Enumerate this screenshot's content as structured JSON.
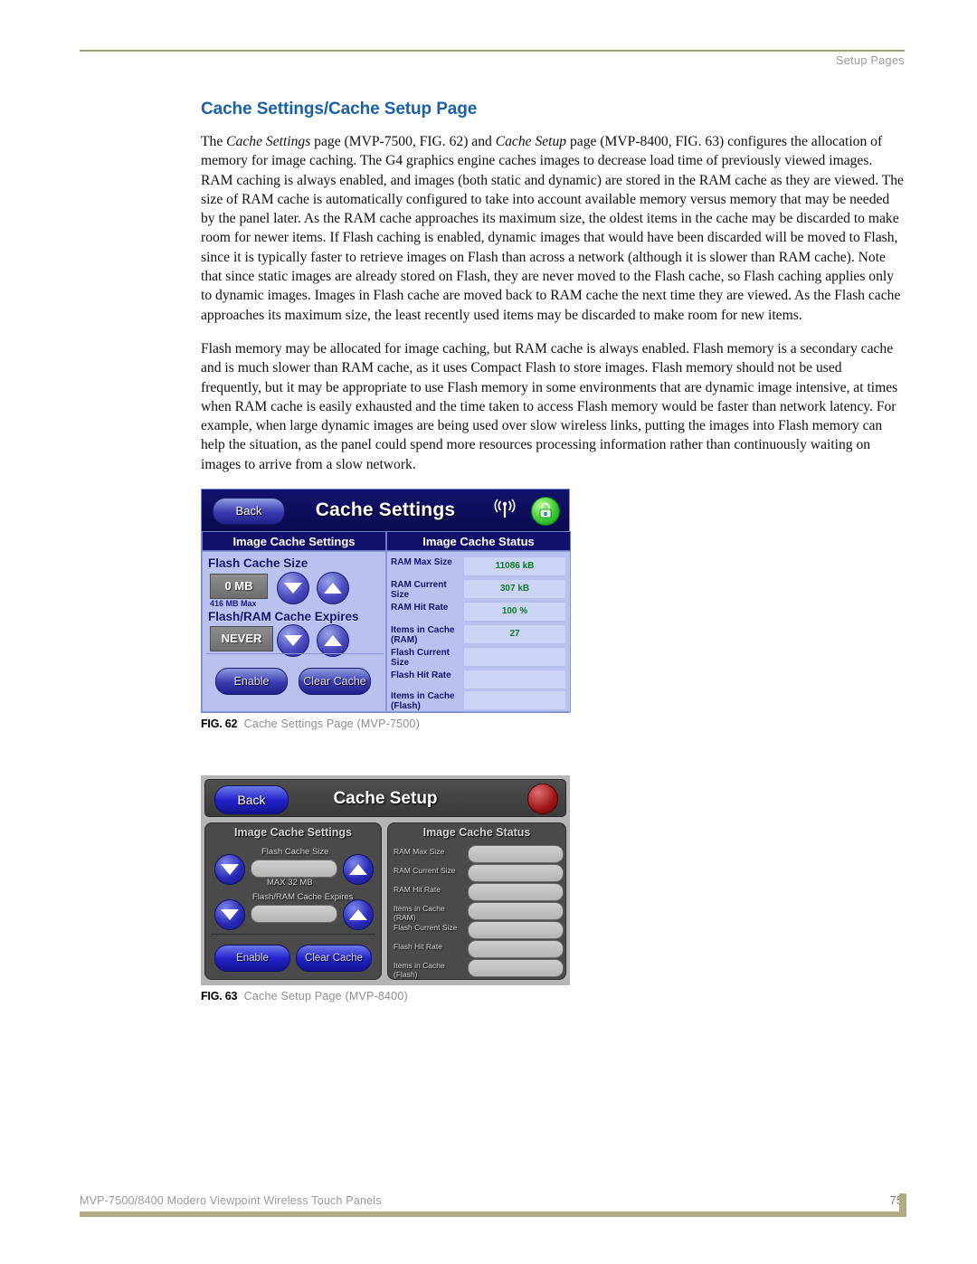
{
  "header": {
    "running_head": "Setup Pages"
  },
  "title": "Cache Settings/Cache Setup Page",
  "paragraphs": {
    "p1_a": "The ",
    "p1_em1": "Cache Settings",
    "p1_b": " page (MVP-7500, FIG. 62) and ",
    "p1_em2": "Cache Setup",
    "p1_c": " page (MVP-8400, FIG. 63) configures the allocation of memory for image caching. The G4 graphics engine caches images to decrease load time of previously viewed images. RAM caching is always enabled, and images (both static and dynamic) are stored in the RAM cache as they are viewed. The size of RAM cache is automatically configured to take into account available memory versus memory that may be needed by the panel later. As the RAM cache approaches its maximum size, the oldest items in the cache may be discarded to make room for newer items. If Flash caching is enabled, dynamic images that would have been discarded will be moved to Flash, since it is typically faster to retrieve images on Flash than across a network (although it is slower than RAM cache). Note that since static images are already stored on Flash, they are never moved to the Flash cache, so Flash caching applies only to dynamic images. Images in Flash cache are moved back to RAM cache the next time they are viewed. As the Flash cache approaches its maximum size, the least recently used items may be discarded to make room for new items.",
    "p2": "Flash memory may be allocated for image caching, but RAM cache is always enabled. Flash memory is a secondary cache and is much slower than RAM cache, as it uses Compact Flash to store images. Flash memory should not be used frequently, but it may be appropriate to use Flash memory in some environments that are dynamic image intensive, at times when RAM cache is easily exhausted and the time taken to access Flash memory would be faster than network latency. For example, when large dynamic images are being used over slow wireless links, putting the images into Flash memory can help the situation, as the panel could spend more resources processing information rather than continuously waiting on images to arrive from a slow network."
  },
  "figure62": {
    "caption_number": "FIG. 62",
    "caption_text": "Cache Settings Page (MVP-7500)",
    "page_title": "Cache Settings",
    "back_label": "Back",
    "wifi_icon": "wifi-signal-icon",
    "lock_icon": "padlock-icon",
    "tabs": [
      "Image Cache Settings",
      "Image Cache Status"
    ],
    "settings": {
      "flash_cache_size_label": "Flash Cache Size",
      "flash_cache_size_value": "0 MB",
      "flash_cache_max_note": "416 MB Max",
      "expires_label": "Flash/RAM Cache Expires",
      "expires_value": "NEVER",
      "enable_label": "Enable",
      "clear_label": "Clear Cache"
    },
    "status_rows": [
      {
        "label": "RAM Max Size",
        "value": "11086 kB"
      },
      {
        "label": "RAM Current Size",
        "value": "307 kB"
      },
      {
        "label": "RAM Hit Rate",
        "value": "100 %"
      },
      {
        "label": "Items in Cache (RAM)",
        "value": "27"
      },
      {
        "label": "Flash Current Size",
        "value": ""
      },
      {
        "label": "Flash Hit Rate",
        "value": ""
      },
      {
        "label": "Items in Cache (Flash)",
        "value": ""
      }
    ]
  },
  "figure63": {
    "caption_number": "FIG. 63",
    "caption_text": "Cache Setup Page (MVP-8400)",
    "page_title": "Cache Setup",
    "back_label": "Back",
    "led_icon": "red-led-indicator",
    "tabs": [
      "Image Cache Settings",
      "Image Cache Status"
    ],
    "settings": {
      "flash_cache_size_label": "Flash Cache Size",
      "flash_cache_size_value": "",
      "flash_cache_max_note": "MAX  32 MB",
      "expires_label": "Flash/RAM Cache Expires",
      "expires_value": "",
      "enable_label": "Enable",
      "clear_label": "Clear Cache"
    },
    "status_rows": [
      {
        "label": "RAM Max Size",
        "value": ""
      },
      {
        "label": "RAM Current Size",
        "value": ""
      },
      {
        "label": "RAM Hit Rate",
        "value": ""
      },
      {
        "label": "Items in Cache (RAM)",
        "value": ""
      },
      {
        "label": "Flash Current Size",
        "value": ""
      },
      {
        "label": "Flash Hit Rate",
        "value": ""
      },
      {
        "label": "Items in Cache (Flash)",
        "value": ""
      }
    ]
  },
  "footer": {
    "text": "MVP-7500/8400 Modero Viewpoint Wireless Touch Panels",
    "page_number": "75"
  }
}
